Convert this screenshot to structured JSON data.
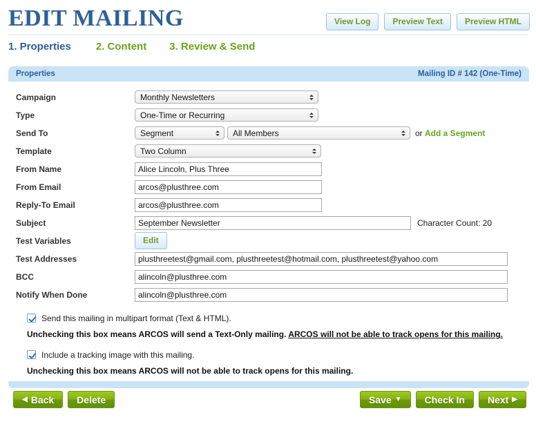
{
  "header": {
    "title": "EDIT MAILING",
    "actions": [
      {
        "label": "View Log",
        "name": "view-log-button"
      },
      {
        "label": "Preview Text",
        "name": "preview-text-button"
      },
      {
        "label": "Preview HTML",
        "name": "preview-html-button"
      }
    ]
  },
  "steps": [
    {
      "label": "1. Properties",
      "state": "active"
    },
    {
      "label": "2. Content",
      "state": "inactive"
    },
    {
      "label": "3. Review & Send",
      "state": "inactive"
    }
  ],
  "panel": {
    "heading": "Properties",
    "meta": "Mailing ID # 142 (One-Time)"
  },
  "fields": {
    "campaign": {
      "label": "Campaign",
      "value": "Monthly Newsletters"
    },
    "type": {
      "label": "Type",
      "value": "One-Time or Recurring"
    },
    "send_to": {
      "label": "Send To",
      "value": "Segment",
      "segment_value": "All Members",
      "or_text": "or ",
      "link_text": "Add a Segment"
    },
    "template": {
      "label": "Template",
      "value": "Two Column"
    },
    "from_name": {
      "label": "From Name",
      "value": "Alice Lincoln, Plus Three",
      "placeholder": ""
    },
    "from_email": {
      "label": "From Email",
      "value": "arcos@plusthree.com",
      "placeholder": ""
    },
    "reply_to": {
      "label": "Reply-To Email",
      "value": "arcos@plusthree.com",
      "placeholder": ""
    },
    "subject": {
      "label": "Subject",
      "value": "September Newsletter",
      "placeholder": "",
      "char_count": "Character Count: 20"
    },
    "test_vars": {
      "label": "Test Variables",
      "button_label": "Edit"
    },
    "test_addresses": {
      "label": "Test Addresses",
      "value": "plusthreetest@gmail.com, plusthreetest@hotmail.com, plusthreetest@yahoo.com",
      "placeholder": ""
    },
    "bcc": {
      "label": "BCC",
      "value": "alincoln@plusthree.com",
      "placeholder": ""
    },
    "notify": {
      "label": "Notify When Done",
      "value": "alincoln@plusthree.com",
      "placeholder": ""
    }
  },
  "checkboxes": {
    "multipart": {
      "label": "Send this mailing in multipart format (Text & HTML).",
      "checked": true,
      "note_plain": "Unchecking this box means ARCOS will send a Text-Only mailing. ",
      "note_underlined": "ARCOS will not be able to track opens for this mailing."
    },
    "tracking_image": {
      "label": "Include a tracking image with this mailing.",
      "checked": true,
      "note_plain": "Unchecking this box means ARCOS will not be able to track opens for this mailing.",
      "note_underlined": ""
    }
  },
  "bottom_bar": {
    "left": [
      {
        "label": "Back",
        "icon": "triangle-left",
        "name": "back-button"
      },
      {
        "label": "Delete",
        "icon": "",
        "name": "delete-button"
      }
    ],
    "right": [
      {
        "label": "Save",
        "icon": "triangle-down",
        "name": "save-button"
      },
      {
        "label": "Check In",
        "icon": "",
        "name": "check-in-button"
      },
      {
        "label": "Next",
        "icon": "triangle-right",
        "name": "next-button"
      }
    ]
  },
  "colors": {
    "title_blue": "#2e6099",
    "accent_green": "#6aa31c",
    "panel_header_blue": "#c9e3f7",
    "button_green": "#86b215"
  }
}
